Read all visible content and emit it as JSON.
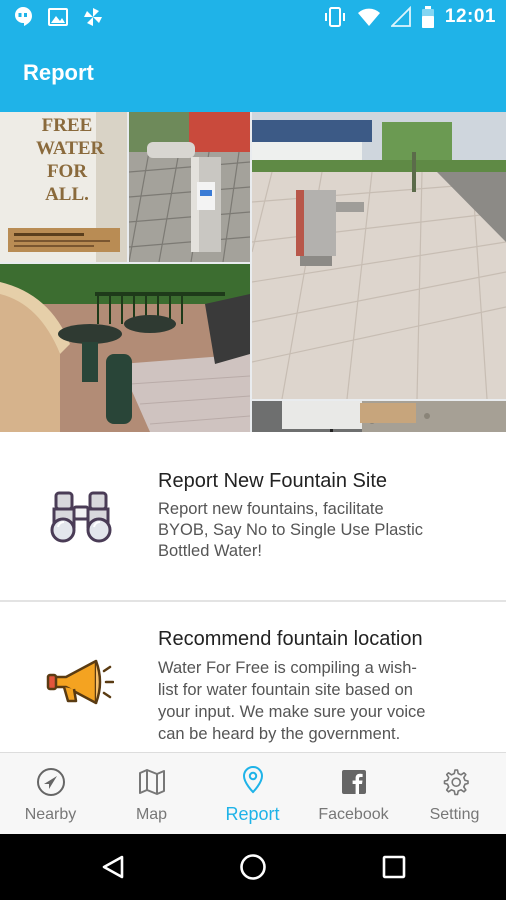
{
  "status_bar": {
    "time": "12:01",
    "left_icons": [
      "hangouts-icon",
      "image-icon",
      "pinwheel-icon"
    ],
    "right_icons": [
      "vibrate-icon",
      "wifi-icon",
      "signal-icon",
      "battery-icon"
    ]
  },
  "header": {
    "title": "Report"
  },
  "colors": {
    "accent": "#1fb3e8",
    "megaphone": "#f4a321"
  },
  "banner": {
    "tiles": [
      "water-for-all-sign",
      "steel-fountain-tiles",
      "fountain-promenade",
      "green-fountain-park",
      "fountain-stone-wall"
    ],
    "sign_text": [
      "FREE",
      "WATER",
      "FOR",
      "ALL."
    ]
  },
  "options": [
    {
      "icon": "binoculars-icon",
      "title": "Report New Fountain Site",
      "lines": [
        "Report new fountains, facilitate",
        "BYOB, Say No to Single Use Plastic",
        "Bottled Water!"
      ]
    },
    {
      "icon": "megaphone-icon",
      "title": "Recommend fountain location",
      "lines": [
        "Water For Free is compiling a wish-",
        "list for water fountain site based on",
        "your input. We make sure your voice",
        "can be heard by the government."
      ]
    }
  ],
  "bottom_nav": [
    {
      "label": "Nearby",
      "icon": "navigation-arrow-icon",
      "active": false
    },
    {
      "label": "Map",
      "icon": "map-icon",
      "active": false
    },
    {
      "label": "Report",
      "icon": "location-pin-icon",
      "active": true
    },
    {
      "label": "Facebook",
      "icon": "facebook-icon",
      "active": false
    },
    {
      "label": "Setting",
      "icon": "gear-icon",
      "active": false
    }
  ],
  "system_nav": [
    "back-icon",
    "home-icon",
    "recents-icon"
  ]
}
